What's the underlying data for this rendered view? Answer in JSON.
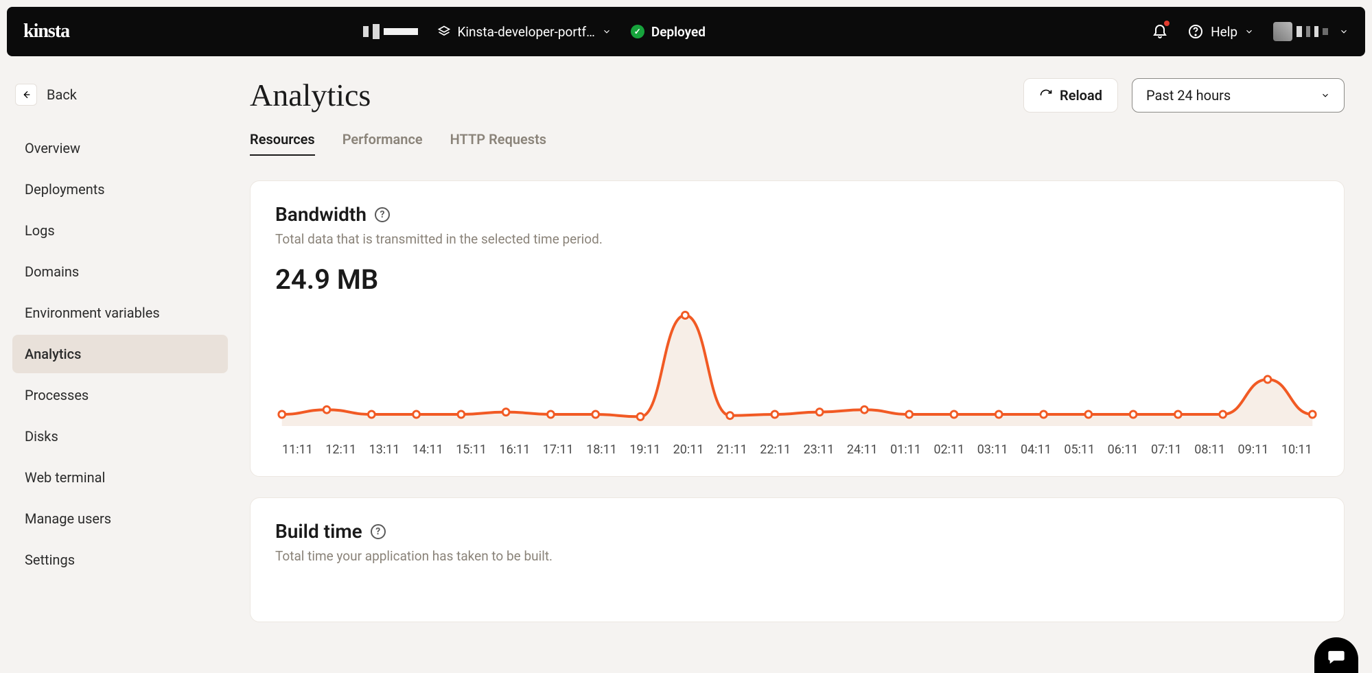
{
  "topbar": {
    "logo": "kinsta",
    "project_name": "Kinsta-developer-portf…",
    "status": "Deployed",
    "help_label": "Help"
  },
  "sidebar": {
    "back_label": "Back",
    "items": [
      {
        "label": "Overview"
      },
      {
        "label": "Deployments"
      },
      {
        "label": "Logs"
      },
      {
        "label": "Domains"
      },
      {
        "label": "Environment variables"
      },
      {
        "label": "Analytics",
        "active": true
      },
      {
        "label": "Processes"
      },
      {
        "label": "Disks"
      },
      {
        "label": "Web terminal"
      },
      {
        "label": "Manage users"
      },
      {
        "label": "Settings"
      }
    ]
  },
  "page": {
    "title": "Analytics",
    "reload_label": "Reload",
    "time_range": "Past 24 hours",
    "tabs": [
      {
        "label": "Resources",
        "active": true
      },
      {
        "label": "Performance"
      },
      {
        "label": "HTTP Requests"
      }
    ]
  },
  "bandwidth_card": {
    "title": "Bandwidth",
    "subtitle": "Total data that is transmitted in the selected time period.",
    "value": "24.9 MB"
  },
  "buildtime_card": {
    "title": "Build time",
    "subtitle": "Total time your application has taken to be built."
  },
  "chart_data": {
    "type": "line",
    "title": "Bandwidth",
    "xlabel": "",
    "ylabel": "",
    "ylim": [
      0,
      100
    ],
    "categories": [
      "11:11",
      "12:11",
      "13:11",
      "14:11",
      "15:11",
      "16:11",
      "17:11",
      "18:11",
      "19:11",
      "20:11",
      "21:11",
      "22:11",
      "23:11",
      "24:11",
      "01:11",
      "02:11",
      "03:11",
      "04:11",
      "05:11",
      "06:11",
      "07:11",
      "08:11",
      "09:11",
      "10:11"
    ],
    "values": [
      10,
      14,
      10,
      10,
      10,
      12,
      10,
      10,
      8,
      95,
      9,
      10,
      12,
      14,
      10,
      10,
      10,
      10,
      10,
      10,
      10,
      10,
      40,
      10
    ]
  }
}
